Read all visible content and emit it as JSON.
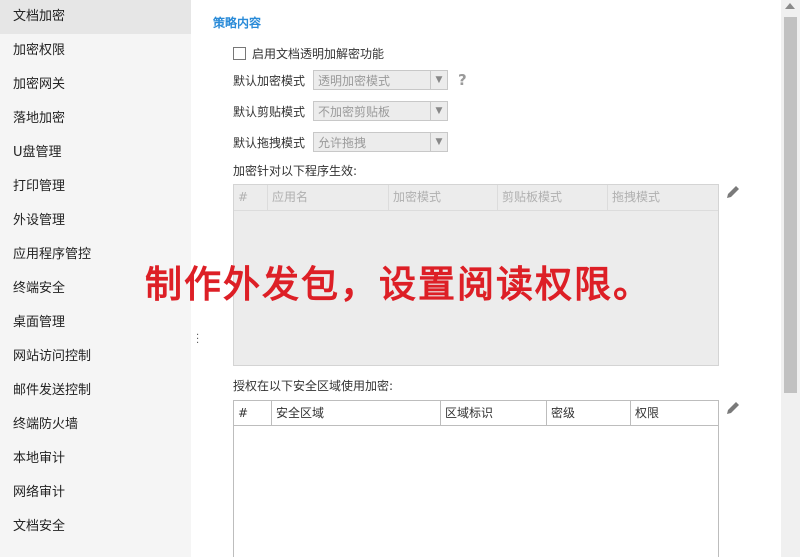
{
  "sidebar": {
    "items": [
      {
        "label": "文档加密",
        "active": true
      },
      {
        "label": "加密权限"
      },
      {
        "label": "加密网关"
      },
      {
        "label": "落地加密"
      },
      {
        "label": "U盘管理"
      },
      {
        "label": "打印管理"
      },
      {
        "label": "外设管理"
      },
      {
        "label": "应用程序管控"
      },
      {
        "label": "终端安全"
      },
      {
        "label": "桌面管理"
      },
      {
        "label": "网站访问控制"
      },
      {
        "label": "邮件发送控制"
      },
      {
        "label": "终端防火墙"
      },
      {
        "label": "本地审计"
      },
      {
        "label": "网络审计"
      },
      {
        "label": "文档安全"
      }
    ]
  },
  "main": {
    "section_title": "策略内容",
    "enable_checkbox": {
      "label": "启用文档透明加解密功能",
      "checked": false
    },
    "settings": [
      {
        "label": "默认加密模式",
        "value": "透明加密模式"
      },
      {
        "label": "默认剪贴模式",
        "value": "不加密剪贴板"
      },
      {
        "label": "默认拖拽模式",
        "value": "允许拖拽"
      }
    ],
    "help_icon": "?",
    "programs_label": "加密针对以下程序生效:",
    "programs_table": {
      "columns": [
        "#",
        "应用名",
        "加密模式",
        "剪贴板模式",
        "拖拽模式"
      ],
      "rows": []
    },
    "zones_label": "授权在以下安全区域使用加密:",
    "zones_table": {
      "columns": [
        "#",
        "安全区域",
        "区域标识",
        "密级",
        "权限"
      ],
      "rows": []
    },
    "icons": {
      "edit": "pencil-icon",
      "help": "question-mark-icon"
    }
  },
  "overlay_caption": "制作外发包，设置阅读权限。",
  "colors": {
    "accent": "#2a8bd8",
    "overlay": "#dd1f26",
    "sidebar_bg": "#f5f5f5"
  }
}
